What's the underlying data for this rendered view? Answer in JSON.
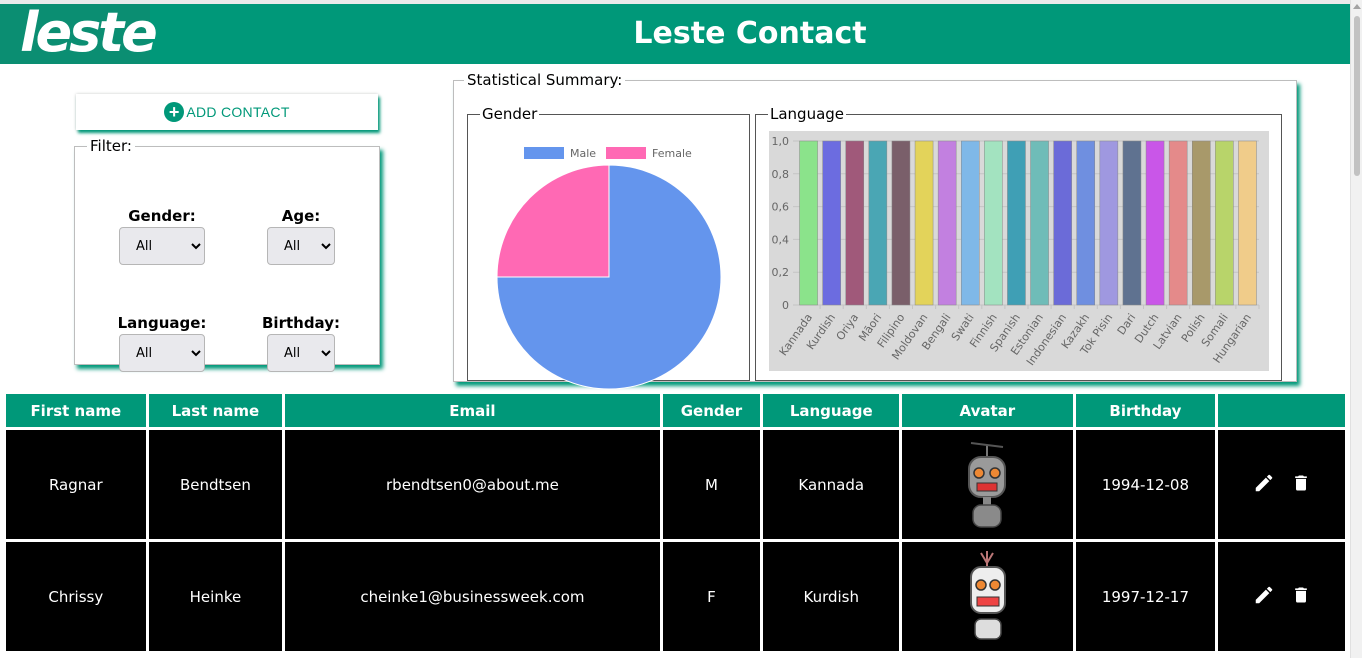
{
  "header": {
    "logo_text": "leste",
    "title": "Leste Contact"
  },
  "actions": {
    "add_contact_label": "ADD CONTACT"
  },
  "filter": {
    "legend": "Filter:",
    "gender": {
      "label": "Gender:",
      "value": "All"
    },
    "age": {
      "label": "Age:",
      "value": "All"
    },
    "language": {
      "label": "Language:",
      "value": "All"
    },
    "birthday": {
      "label": "Birthday:",
      "value": "All"
    }
  },
  "summary": {
    "legend": "Statistical Summary:",
    "gender_legend": "Gender",
    "language_legend": "Language"
  },
  "chart_data": [
    {
      "type": "pie",
      "categories": [
        "Male",
        "Female"
      ],
      "values": [
        3,
        1
      ],
      "colors": [
        "#6495ED",
        "#FF69B4"
      ],
      "legend_position": "top"
    },
    {
      "type": "bar",
      "categories": [
        "Kannada",
        "Kurdish",
        "Oriya",
        "Māori",
        "Filipino",
        "Moldovan",
        "Bengali",
        "Swati",
        "Finnish",
        "Spanish",
        "Estonian",
        "Indonesian",
        "Kazakh",
        "Tok Pisin",
        "Dari",
        "Dutch",
        "Latvian",
        "Polish",
        "Somali",
        "Hungarian"
      ],
      "values": [
        1,
        1,
        1,
        1,
        1,
        1,
        1,
        1,
        1,
        1,
        1,
        1,
        1,
        1,
        1,
        1,
        1,
        1,
        1,
        1
      ],
      "colors": [
        "#8be38b",
        "#6c6ce0",
        "#a0597a",
        "#4aa6b4",
        "#7a5f6a",
        "#e3d35a",
        "#c280e0",
        "#7fb8e8",
        "#a3e3c0",
        "#3f9fb5",
        "#6fbcb8",
        "#6b6bd8",
        "#6f8fe0",
        "#9f98e0",
        "#5f7290",
        "#c956e8",
        "#e48a8a",
        "#a8996a",
        "#b8d46a",
        "#f0cc8a"
      ],
      "ylim": [
        0,
        1.0
      ],
      "yticks": [
        "0",
        "0,2",
        "0,4",
        "0,6",
        "0,8",
        "1,0"
      ],
      "grid": true,
      "legend": false
    }
  ],
  "table": {
    "headers": [
      "First name",
      "Last name",
      "Email",
      "Gender",
      "Language",
      "Avatar",
      "Birthday",
      ""
    ],
    "rows": [
      {
        "first": "Ragnar",
        "last": "Bendtsen",
        "email": "rbendtsen0@about.me",
        "gender": "M",
        "language": "Kannada",
        "avatar": "robot-avatar",
        "birthday": "1994-12-08"
      },
      {
        "first": "Chrissy",
        "last": "Heinke",
        "email": "cheinke1@businessweek.com",
        "gender": "F",
        "language": "Kurdish",
        "avatar": "robot-avatar",
        "birthday": "1997-12-17"
      }
    ]
  },
  "icons": {
    "add": "plus-circle-icon",
    "edit": "pencil-icon",
    "delete": "trash-icon"
  },
  "colors": {
    "brand": "#009879",
    "row_bg": "#000000"
  }
}
